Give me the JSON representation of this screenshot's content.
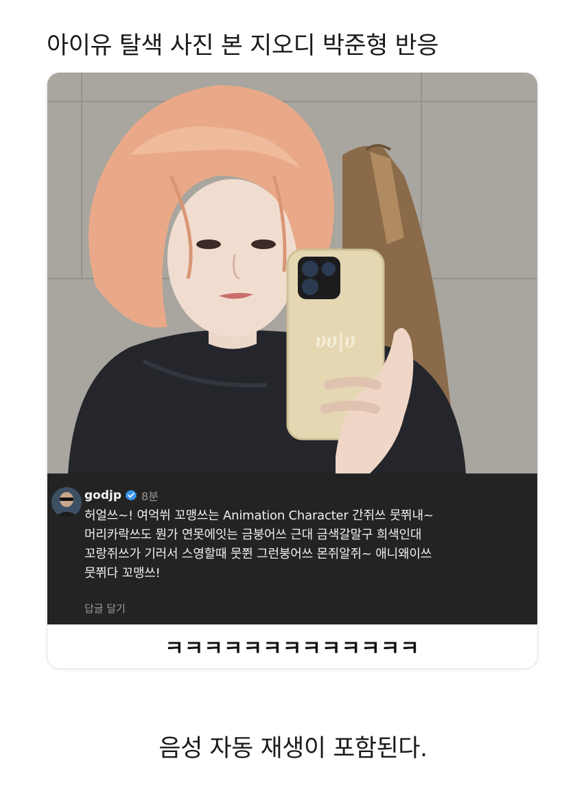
{
  "headline": "아이유 탈색 사진 본 지오디 박준형 반응",
  "photo": {
    "phone_case_text": "ሀሀ|ሀ",
    "icon": "person-photo"
  },
  "comment": {
    "username": "godjp",
    "verified_icon": "verified-badge-icon",
    "time": "8분",
    "lines": [
      "허얼쓰~! 여억쒸 꼬맹쓰는 Animation Character 간쥐쓰 뭇쮜내~",
      "머리카락쓰도 뭔가 연못에잇는 금붕어쓰 근대 금색갈말구 희색인대",
      "꼬랑쥐쓰가 기러서 스영할때 뭇쮠 그런붕어쓰 몬쥐알쥐~ 애니왜이쓰",
      "뭇쮜다 꼬맹쓰!"
    ],
    "reply_label": "답글 달기"
  },
  "laugh_text": "ㅋㅋㅋㅋㅋㅋㅋㅋㅋㅋㅋㅋㅋ",
  "footer": "음성 자동 재생이 포함된다.",
  "colors": {
    "comment_bg": "#232323",
    "verified": "#3897f0",
    "muted": "#9a9a9a"
  }
}
